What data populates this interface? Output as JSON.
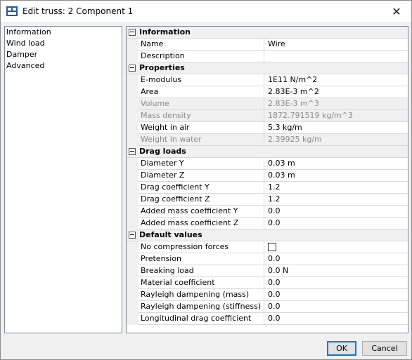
{
  "window": {
    "title": "Edit truss: 2 Component 1"
  },
  "nav": {
    "items": [
      {
        "label": "Information"
      },
      {
        "label": "Wind load"
      },
      {
        "label": "Damper"
      },
      {
        "label": "Advanced"
      }
    ]
  },
  "grid": {
    "information": {
      "header": "Information",
      "name_label": "Name",
      "name_value": "Wire",
      "description_label": "Description",
      "description_value": ""
    },
    "properties": {
      "header": "Properties",
      "emod_label": "E-modulus",
      "emod_value": "1E11 N/m^2",
      "area_label": "Area",
      "area_value": "2.83E-3 m^2",
      "volume_label": "Volume",
      "volume_value": "2.83E-3 m^3",
      "massdens_label": "Mass density",
      "massdens_value": "1872.791519 kg/m^3",
      "wair_label": "Weight in air",
      "wair_value": "5.3 kg/m",
      "wwater_label": "Weight in water",
      "wwater_value": "2.39925 kg/m"
    },
    "drag": {
      "header": "Drag loads",
      "diay_label": "Diameter Y",
      "diay_value": "0.03 m",
      "diaz_label": "Diameter Z",
      "diaz_value": "0.03 m",
      "cdy_label": "Drag coefficient Y",
      "cdy_value": "1.2",
      "cdz_label": "Drag coefficient Z",
      "cdz_value": "1.2",
      "cmy_label": "Added mass coefficient Y",
      "cmy_value": "0.0",
      "cmz_label": "Added mass coefficient Z",
      "cmz_value": "0.0"
    },
    "defaults": {
      "header": "Default values",
      "nocomp_label": "No compression forces",
      "pret_label": "Pretension",
      "pret_value": "0.0",
      "brk_label": "Breaking load",
      "brk_value": "0.0 N",
      "matc_label": "Material coefficient",
      "matc_value": "0.0",
      "rdm_label": "Rayleigh dampening (mass)",
      "rdm_value": "0.0",
      "rds_label": "Rayleigh dampening (stiffness)",
      "rds_value": "0.0",
      "ldc_label": "Longitudinal drag coefficient",
      "ldc_value": "0.0"
    }
  },
  "buttons": {
    "ok": "OK",
    "cancel": "Cancel"
  }
}
